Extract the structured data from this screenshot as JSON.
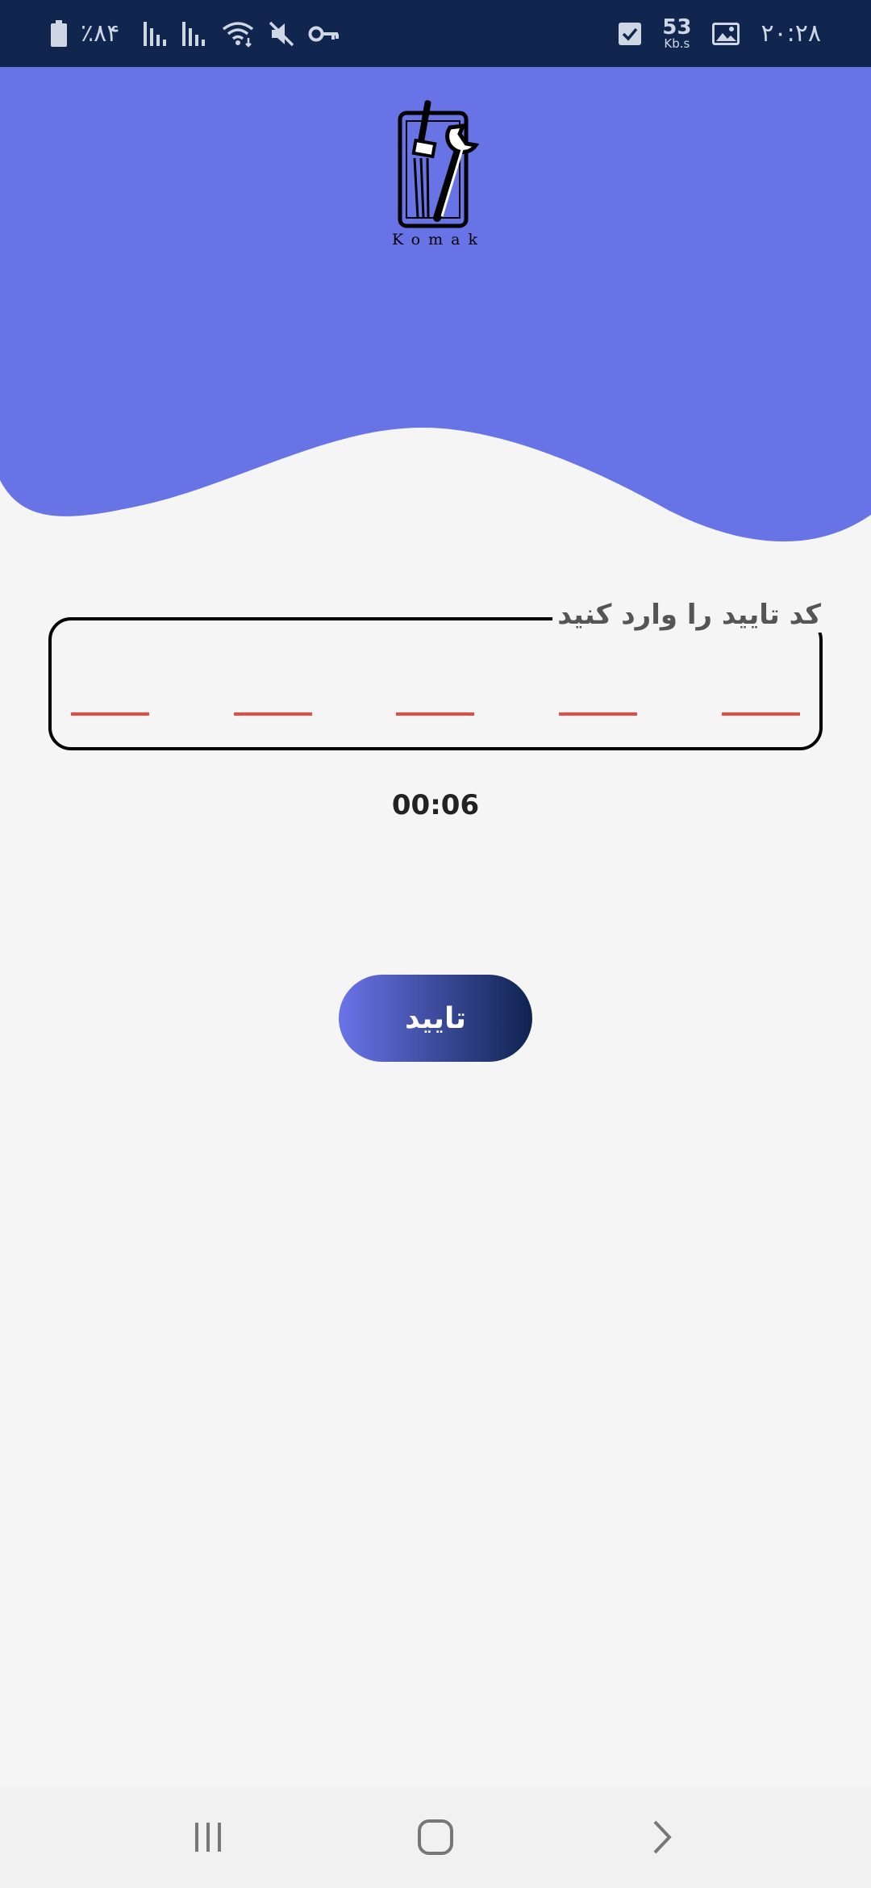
{
  "status_bar": {
    "battery_text": "٪۸۴",
    "time": "۲۰:۲۸",
    "speed_value": "53",
    "speed_unit": "Kb.s",
    "icons": [
      "battery-icon",
      "signal-icon",
      "signal-icon",
      "wifi-icon",
      "mute-icon",
      "vpn-key-icon",
      "checkbox-notification-icon",
      "image-notification-icon"
    ]
  },
  "header": {
    "logo_text": "Komak",
    "background_color": "#6874e6"
  },
  "verification": {
    "label": "کد تایید را وارد کنید",
    "slot_count": 5,
    "slot_color": "#e54d42"
  },
  "timer": "00:06",
  "confirm_button": {
    "label": "تایید"
  },
  "nav_bar": {
    "icons": [
      "recent-apps-icon",
      "home-icon",
      "back-icon"
    ]
  }
}
